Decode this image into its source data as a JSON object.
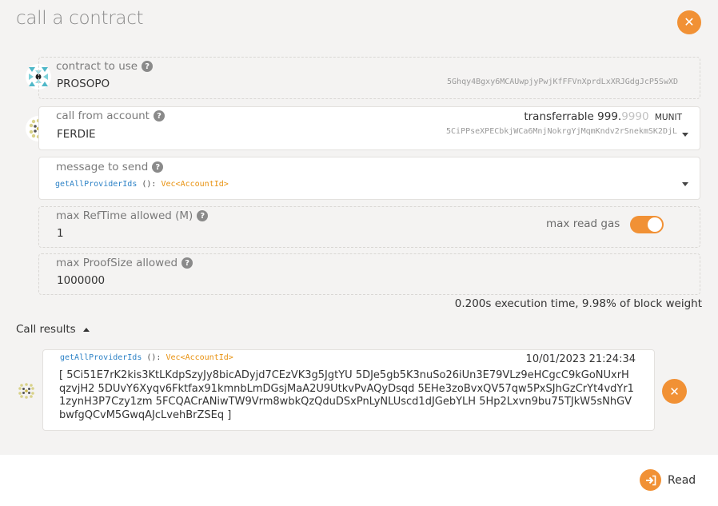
{
  "modal": {
    "title": "call a contract",
    "close_icon": "close-icon"
  },
  "contract": {
    "label": "contract to use",
    "name": "PROSOPO",
    "address": "5Ghqy4Bgxy6MCAUwpjyPwjKfFFVnXprdLxXRJGdgJcP5SwXD"
  },
  "account": {
    "label": "call from account",
    "name": "FERDIE",
    "address": "5CiPPseXPECbkjWCa6MnjNokrgYjMqmKndv2rSnekmSK2DjL",
    "balance_label": "transferrable",
    "balance_main": "999.",
    "balance_decimals": "9990",
    "balance_unit": "MUNIT"
  },
  "message": {
    "label": "message to send",
    "name": "getAllProviderIds",
    "params": "():",
    "return_type": "Vec<AccountId>"
  },
  "reftime": {
    "label": "max RefTime allowed (M)",
    "value": "1",
    "toggle_label": "max read gas",
    "toggle_on": true
  },
  "proofsize": {
    "label": "max ProofSize allowed",
    "value": "1000000"
  },
  "execution_info": "0.200s execution time, 9.98% of block weight",
  "results": {
    "heading": "Call results",
    "item": {
      "message_name": "getAllProviderIds",
      "message_params": "():",
      "message_return": "Vec<AccountId>",
      "timestamp": "10/01/2023 21:24:34",
      "output": "[ 5Ci51E7rK2kis3KtLKdpSzyJy8bicADyjd7CEzVK3g5JgtYU 5DJe5gb5K3nuSo26iUn3E79VLz9eHCgcC9kGoNUxrHqzvjH2 5DUvY6Xyqv6Fktfax91kmnbLmDGsjMaA2U9UtkvPvAQyDsqd 5EHe3zoBvxQV57qw5PxSJhGzCrYt4vdYr11zynH3P7Czy1zm 5FCQACrANiwTW9Vrm8wbkQzQduDSxPnLyNLUscd1dJGebYLH 5Hp2Lxvn9bu75TJkW5sNhGVbwfgQCvM5GwqAJcLvehBrZSEq ]"
    }
  },
  "footer": {
    "read_label": "Read"
  },
  "colors": {
    "accent": "#f19135",
    "message_name": "#2d82c6",
    "return_type": "#e8910f"
  }
}
